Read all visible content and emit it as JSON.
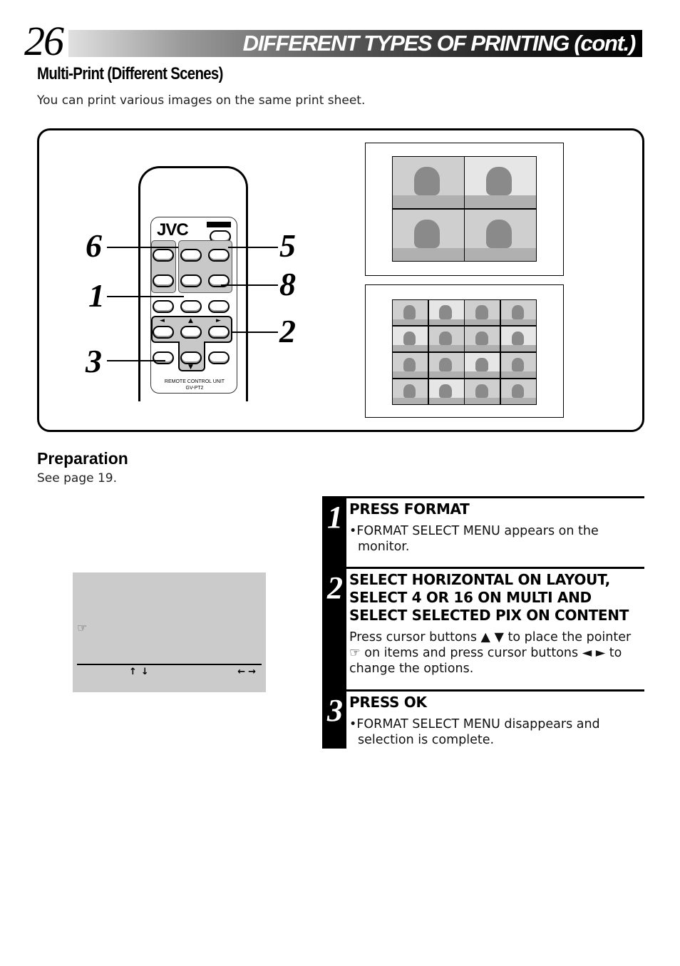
{
  "header": {
    "page_number": "26",
    "title": "DIFFERENT TYPES OF PRINTING (cont.)"
  },
  "section": {
    "title": "Multi-Print (Different Scenes)",
    "description": "You can print various images on the same print sheet."
  },
  "remote": {
    "brand": "JVC",
    "label_line1": "REMOTE CONTROL UNIT",
    "label_line2": "GV-PT2",
    "callouts": [
      "6",
      "1",
      "3",
      "5",
      "8",
      "2"
    ],
    "arrow_left": "◄",
    "arrow_up": "▲",
    "arrow_right": "►",
    "arrow_down": "▼"
  },
  "print_samples": [
    {
      "name": "4-image multi print",
      "grid": "2x2",
      "count": 4
    },
    {
      "name": "16-image multi print",
      "grid": "4x4",
      "count": 16
    }
  ],
  "preparation": {
    "title": "Preparation",
    "text": "See page 19."
  },
  "menu_screen": {
    "pointer_icon": "☞",
    "updown_arrows": "↑↓",
    "leftright_arrows": "←→"
  },
  "steps": [
    {
      "number": "1",
      "title": "PRESS FORMAT",
      "body": "•FORMAT SELECT MENU appears on the monitor."
    },
    {
      "number": "2",
      "title": "SELECT HORIZONTAL ON LAYOUT, SELECT 4 OR 16 ON MULTI AND SELECT SELECTED PIX ON CONTENT",
      "body": "Press cursor buttons ▲ ▼ to place the pointer ☞ on items and press cursor buttons ◄ ► to change the options."
    },
    {
      "number": "3",
      "title": "PRESS OK",
      "body": "•FORMAT SELECT MENU disappears and selection is complete."
    }
  ]
}
